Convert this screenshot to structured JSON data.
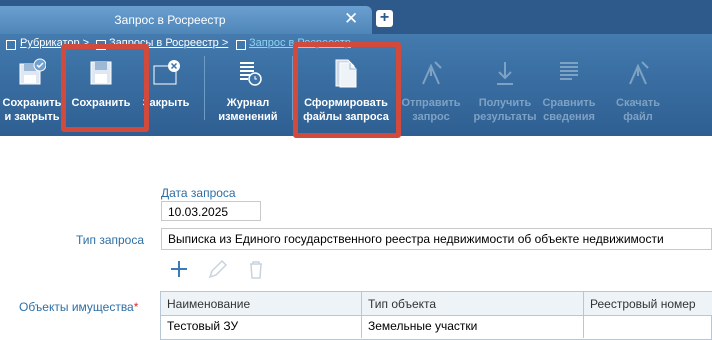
{
  "tab": {
    "title": "Запрос в Росреестр"
  },
  "breadcrumb": [
    "Рубрикатор >",
    "Запросы в Росреестр >",
    "Запрос в Росреестр"
  ],
  "toolbar": {
    "save_close": [
      "Сохранить",
      "и закрыть"
    ],
    "save": "Сохранить",
    "close": "Закрыть",
    "journal": [
      "Журнал",
      "изменений"
    ],
    "generate": [
      "Сформировать",
      "файлы запроса"
    ],
    "send": [
      "Отправить",
      "запрос"
    ],
    "get": [
      "Получить",
      "результаты"
    ],
    "compare": [
      "Сравнить",
      "сведения"
    ],
    "download": [
      "Скачать",
      "файл"
    ]
  },
  "form": {
    "date_label": "Дата запроса",
    "date_value": "10.03.2025",
    "type_label": "Тип запроса",
    "type_value": "Выписка из Единого государственного реестра недвижимости об объекте недвижимости",
    "objects_label": "Объекты имущества",
    "required_mark": "*"
  },
  "table": {
    "columns": [
      "Наименование",
      "Тип объекта",
      "Реестровый номер"
    ],
    "rows": [
      [
        "Тестовый ЗУ",
        "Земельные участки",
        ""
      ]
    ]
  },
  "colors": {
    "highlight": "#d24a3c",
    "toolbar": "#3e74a8",
    "label": "#2e6fa5"
  }
}
